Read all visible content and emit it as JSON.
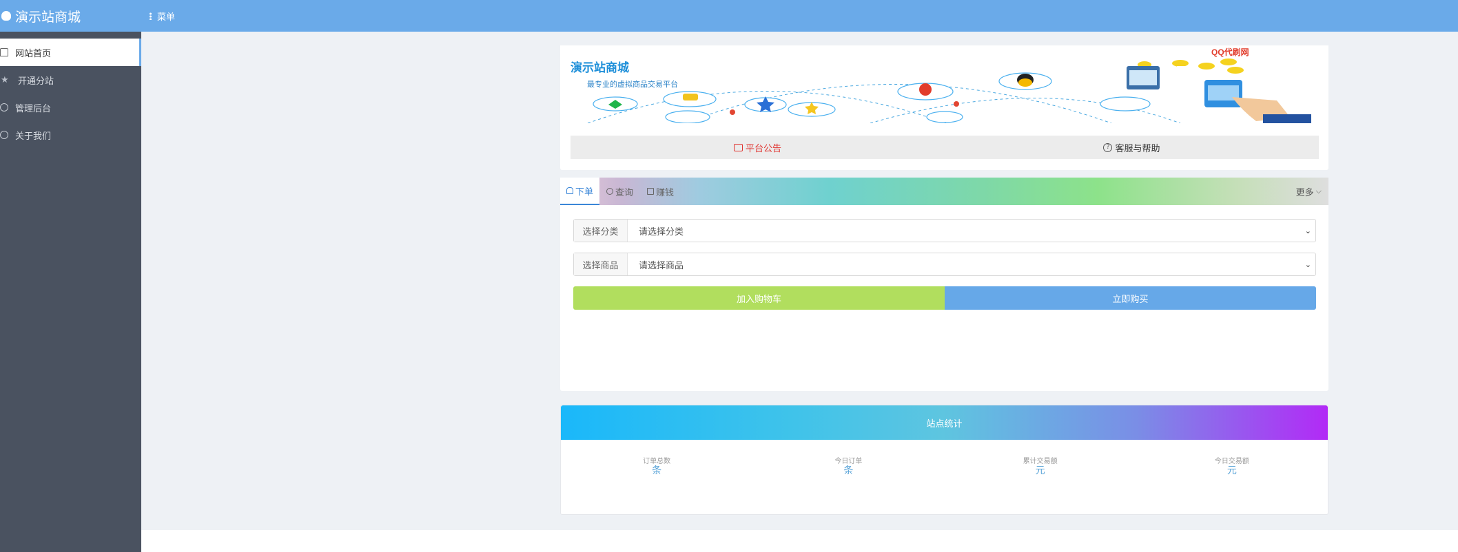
{
  "app": {
    "title": "演示站商城",
    "menu_label": "菜单"
  },
  "sidebar": {
    "items": [
      {
        "label": "网站首页",
        "icon": "home-icon",
        "active": true
      },
      {
        "label": "开通分站",
        "icon": "star-icon",
        "active": false
      },
      {
        "label": "管理后台",
        "icon": "user-circle-icon",
        "active": false
      },
      {
        "label": "关于我们",
        "icon": "info-icon",
        "active": false
      }
    ]
  },
  "banner": {
    "title": "演示站商城",
    "subtitle": "最专业的虚拟商品交易平台",
    "logo_text": "QQ代刷网"
  },
  "notice_bar": {
    "notice_label": "平台公告",
    "help_label": "客服与帮助"
  },
  "tabs": {
    "items": [
      {
        "label": "下单",
        "icon": "bag-icon",
        "active": true
      },
      {
        "label": "查询",
        "icon": "search-icon",
        "active": false
      },
      {
        "label": "赚钱",
        "icon": "wallet-icon",
        "active": false
      }
    ],
    "more_label": "更多"
  },
  "form": {
    "category_label": "选择分类",
    "category_value": "请选择分类",
    "product_label": "选择商品",
    "product_value": "请选择商品",
    "add_cart_label": "加入购物车",
    "buy_now_label": "立即购买"
  },
  "stats": {
    "title": "站点统计",
    "items": [
      {
        "label": "订单总数",
        "unit": "条"
      },
      {
        "label": "今日订单",
        "unit": "条"
      },
      {
        "label": "累计交易额",
        "unit": "元"
      },
      {
        "label": "今日交易额",
        "unit": "元"
      }
    ]
  },
  "colors": {
    "topbar": "#6aaae9",
    "sidebar": "#4a5260",
    "add_cart": "#b1de5e",
    "buy_now": "#66a8e8",
    "notice": "#e0322e"
  }
}
